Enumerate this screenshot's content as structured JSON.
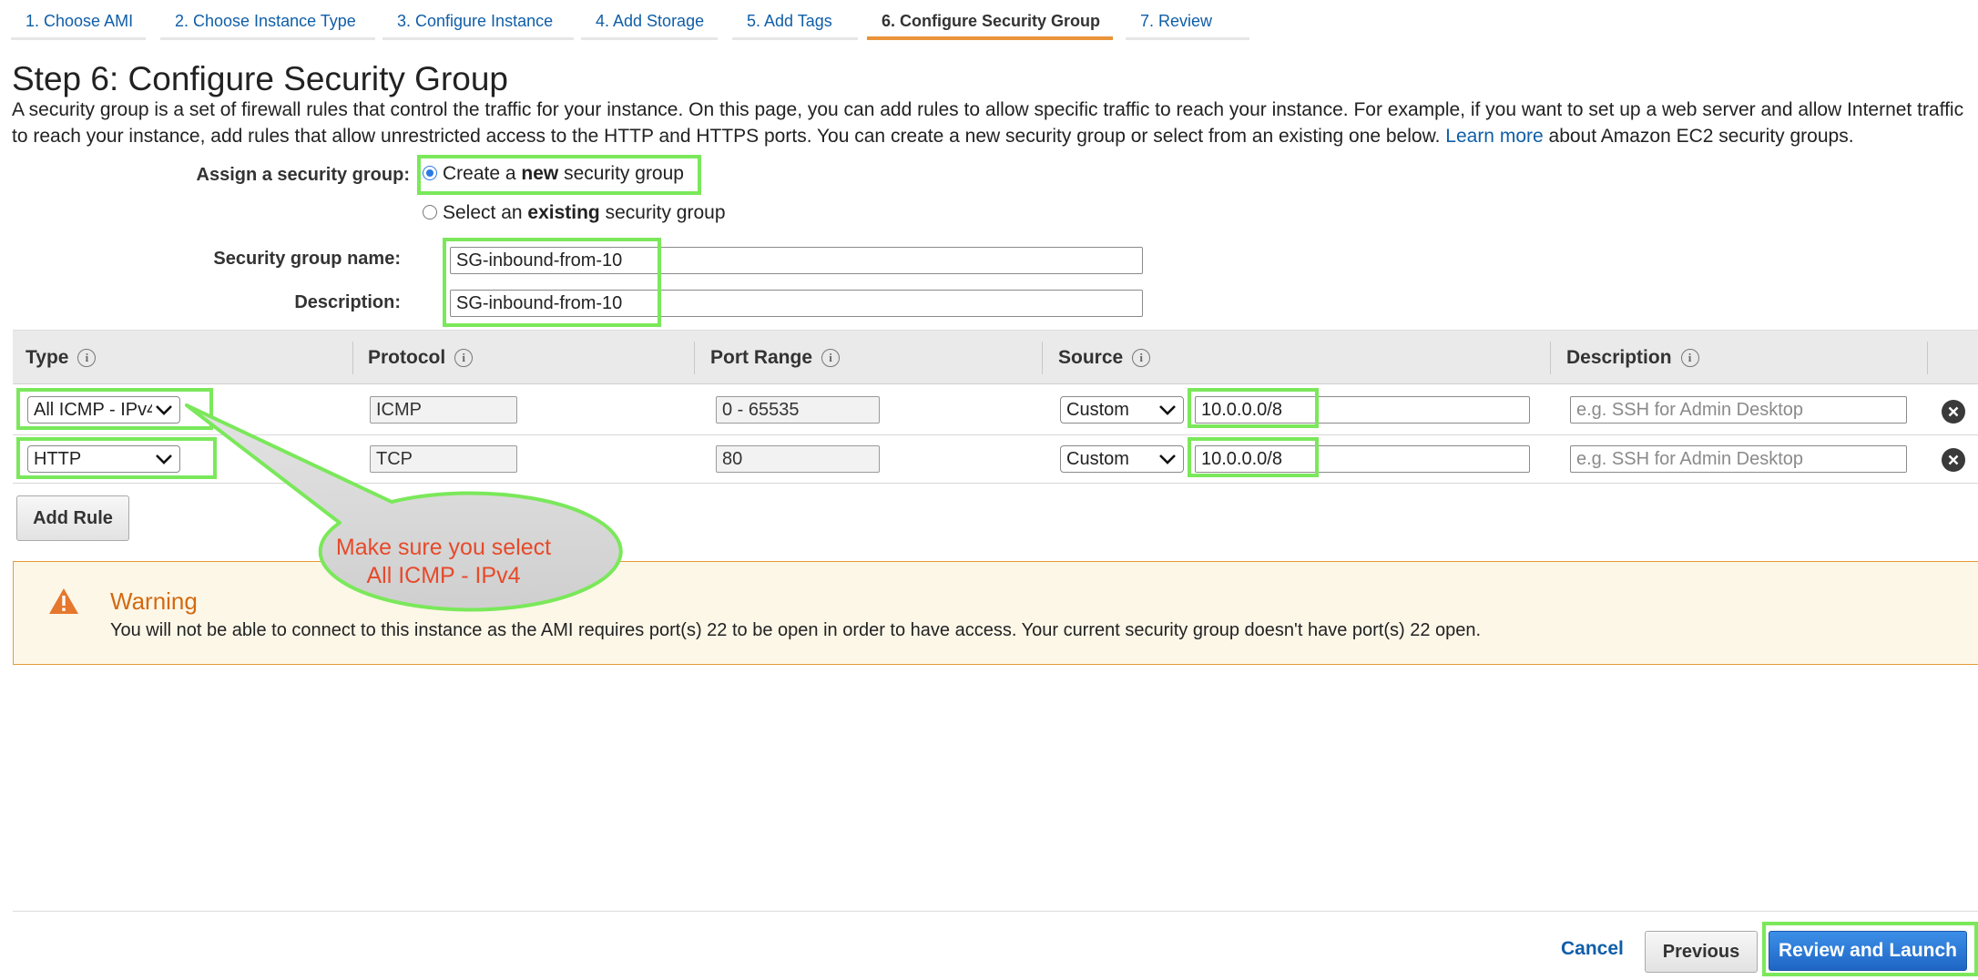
{
  "tabs": [
    {
      "label": "1. Choose AMI"
    },
    {
      "label": "2. Choose Instance Type"
    },
    {
      "label": "3. Configure Instance"
    },
    {
      "label": "4. Add Storage"
    },
    {
      "label": "5. Add Tags"
    },
    {
      "label": "6. Configure Security Group",
      "active": true
    },
    {
      "label": "7. Review"
    }
  ],
  "page": {
    "title": "Step 6: Configure Security Group",
    "intro_text": "A security group is a set of firewall rules that control the traffic for your instance. On this page, you can add rules to allow specific traffic to reach your instance. For example, if you want to set up a web server and allow Internet traffic to reach your instance, add rules that allow unrestricted access to the HTTP and HTTPS ports. You can create a new security group or select from an existing one below.",
    "learn_more": "Learn more",
    "intro_suffix": "about Amazon EC2 security groups."
  },
  "assign": {
    "label": "Assign a security group:",
    "create_pre": "Create a",
    "create_bold": "new",
    "create_post": "security group",
    "existing_pre": "Select an",
    "existing_bold": "existing",
    "existing_post": "security group",
    "selected": "create"
  },
  "group": {
    "name_label": "Security group name:",
    "name_value": "SG-inbound-from-10",
    "desc_label": "Description:",
    "desc_value": "SG-inbound-from-10"
  },
  "table": {
    "headers": {
      "type": "Type",
      "protocol": "Protocol",
      "port_range": "Port Range",
      "source": "Source",
      "description": "Description"
    },
    "rows": [
      {
        "type": "All ICMP - IPv4",
        "protocol": "ICMP",
        "port_range": "0 - 65535",
        "source_type": "Custom",
        "source_value": "10.0.0.0/8",
        "description_placeholder": "e.g. SSH for Admin Desktop"
      },
      {
        "type": "HTTP",
        "protocol": "TCP",
        "port_range": "80",
        "source_type": "Custom",
        "source_value": "10.0.0.0/8",
        "description_placeholder": "e.g. SSH for Admin Desktop"
      }
    ]
  },
  "add_rule": "Add Rule",
  "callout": {
    "line1": "Make sure you select",
    "line2": "All ICMP - IPv4"
  },
  "warning": {
    "title": "Warning",
    "text": "You will not be able to connect to this instance as the AMI requires port(s) 22 to be open in order to have access. Your current security group doesn't have port(s) 22 open."
  },
  "footer": {
    "cancel": "Cancel",
    "previous": "Previous",
    "review": "Review and Launch"
  },
  "colors": {
    "link": "#0f5ea8",
    "highlight": "#7ae85a",
    "warning_border": "#e69b35",
    "warning_title": "#d36a10",
    "callout_text": "#e64a2a",
    "primary_button": "#1f66c4"
  }
}
